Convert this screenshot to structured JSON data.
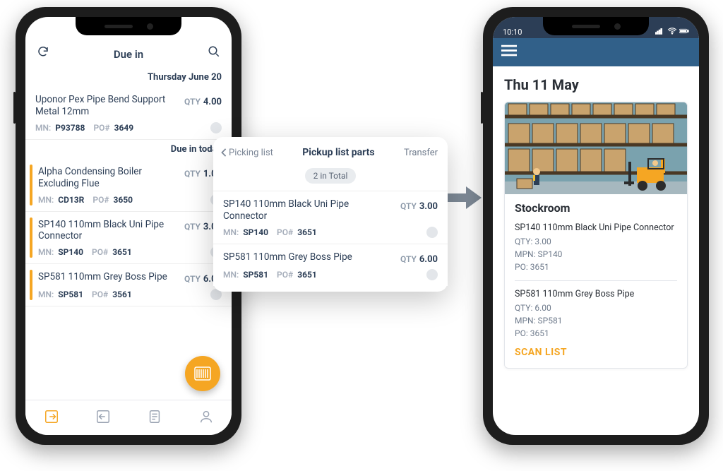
{
  "phone1": {
    "header_title": "Due in",
    "sections": [
      {
        "label": "Thursday June 20",
        "items": [
          {
            "name": "Uponor Pex Pipe Bend Support Metal 12mm",
            "qty": "4.00",
            "mn": "P93788",
            "po": "3649",
            "accent": false
          }
        ]
      },
      {
        "label": "Due in today",
        "items": [
          {
            "name": "Alpha Condensing Boiler Excluding Flue",
            "qty": "1.00",
            "mn": "CD13R",
            "po": "3650",
            "accent": true
          },
          {
            "name": "SP140 110mm Black Uni Pipe Connector",
            "qty": "3.00",
            "mn": "SP140",
            "po": "3651",
            "accent": true
          },
          {
            "name": "SP581 110mm Grey Boss Pipe",
            "qty": "6.00",
            "mn": "SP581",
            "po": "3561",
            "accent": true
          }
        ]
      }
    ],
    "labels": {
      "qty": "QTY",
      "mn": "MN:",
      "po": "PO#"
    }
  },
  "popup": {
    "back_label": "Picking list",
    "title": "Pickup list parts",
    "transfer_label": "Transfer",
    "chip": "2 in Total",
    "items": [
      {
        "name": "SP140 110mm Black Uni Pipe Connector",
        "qty": "3.00",
        "mn": "SP140",
        "po": "3651"
      },
      {
        "name": "SP581 110mm Grey Boss Pipe",
        "qty": "6.00",
        "mn": "SP581",
        "po": "3651"
      }
    ],
    "labels": {
      "qty": "QTY",
      "mn": "MN:",
      "po": "PO#"
    }
  },
  "phone2": {
    "time": "10:10",
    "date": "Thu 11 May",
    "card_title": "Stockroom",
    "scan_label": "SCAN LIST",
    "labels": {
      "qty": "QTY:",
      "mpn": "MPN:",
      "po": "PO:"
    },
    "items": [
      {
        "name": "SP140 110mm Black Uni Pipe Connector",
        "qty": "3.00",
        "mpn": "SP140",
        "po": "3651"
      },
      {
        "name": "SP581 110mm Grey Boss Pipe",
        "qty": "6.00",
        "mpn": "SP581",
        "po": "3651"
      }
    ]
  }
}
